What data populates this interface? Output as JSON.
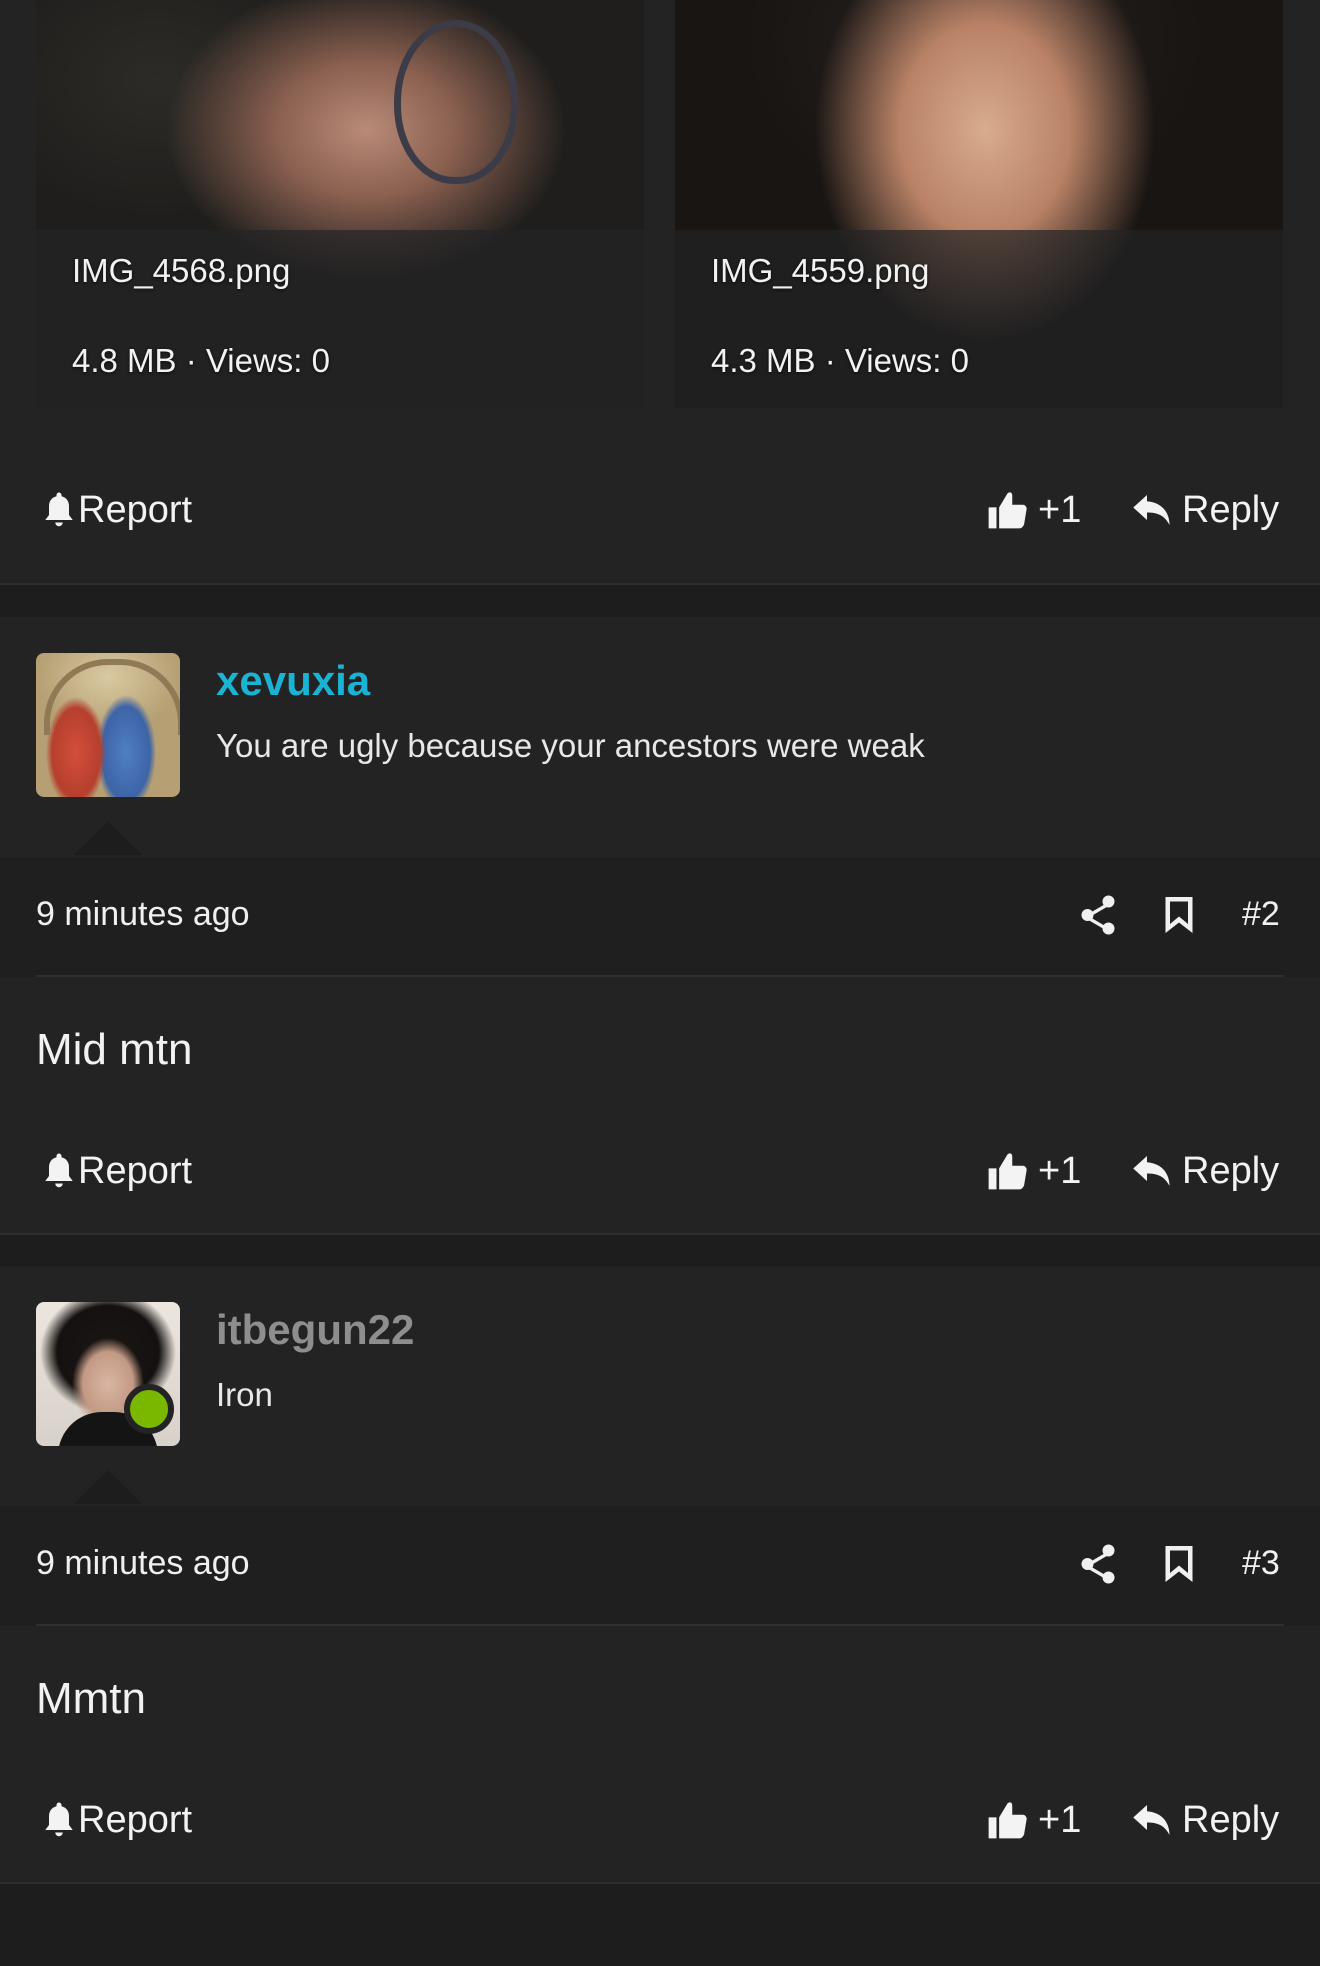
{
  "attachments": [
    {
      "filename": "IMG_4568.png",
      "info": "4.8 MB · Views: 0"
    },
    {
      "filename": "IMG_4559.png",
      "info": "4.3 MB · Views: 0"
    }
  ],
  "labels": {
    "report": "Report",
    "like": "+1",
    "reply": "Reply"
  },
  "posts": [
    {
      "username": "xevuxia",
      "tagline": "You are ugly because your ancestors were weak",
      "time": "9 minutes ago",
      "number": "#2",
      "body": "Mid mtn",
      "username_color": "#1ab3d3",
      "online": false
    },
    {
      "username": "itbegun22",
      "tagline": "Iron",
      "time": "9 minutes ago",
      "number": "#3",
      "body": "Mmtn",
      "username_color": "#8e8e8e",
      "online": true
    }
  ],
  "colors": {
    "background": "#1d1d1e",
    "post_background": "#232324",
    "online_status": "#7ab800"
  }
}
